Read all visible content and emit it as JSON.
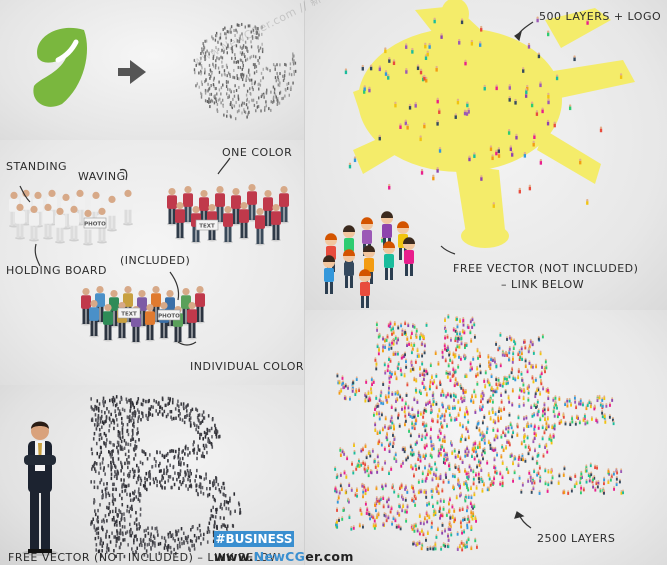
{
  "labels": {
    "layers_logo": "500 LAYERS + LOGO",
    "standing": "STANDING",
    "waving": "WAVING",
    "one_color": "ONE COLOR",
    "holding_board": "HOLDING BOARD",
    "included": "(INCLUDED)",
    "individual_colors": "INDIVIDUAL COLORS",
    "free_vector_1": "FREE VECTOR (NOT INCLUDED)",
    "free_vector_1b": "– LINK BELOW",
    "free_vector_2": "FREE VECTOR (NOT INCLUDED) – LINK BELOW",
    "layers_2500": "2500 LAYERS",
    "board_text": "TEXT",
    "board_photo": "PHOTO",
    "letter": "B"
  },
  "branding": {
    "badge": "#BUSINESS",
    "site_prefix": "www.",
    "site_accent": "NewCG",
    "site_suffix": "er.com",
    "watermark": "www.NewCGer.com // 新CG儿 // www.NewCGer.com"
  },
  "colors": {
    "logo_green": "#7ab73e",
    "sun_yellow": "#f4ec6a",
    "badge_blue": "#3a8fd0"
  }
}
